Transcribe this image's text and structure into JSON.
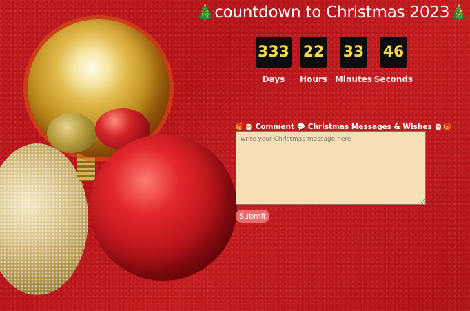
{
  "header": {
    "title_prefix_icon": "christmas-tree-icon",
    "title": "countdown to Christmas 2023",
    "title_suffix_icon": "christmas-tree-icon"
  },
  "countdown": {
    "days": "333",
    "hours": "22",
    "minutes": "33",
    "seconds": "46",
    "days_label": "Days",
    "hours_label": "Hours",
    "minutes_label": "Minutes",
    "seconds_label": "Seconds"
  },
  "comment": {
    "heading_comment": "Comment",
    "heading_messages": "Christmas Messages & Wishes",
    "placeholder": "write your Christmas message here",
    "submit_label": "Submit"
  },
  "colors": {
    "background": "#c21a1f",
    "countdown_box": "#0d0d0d",
    "countdown_digits": "#f4d84a",
    "comment_box": "#f6dfb5",
    "submit_button": "#e96d6d"
  }
}
